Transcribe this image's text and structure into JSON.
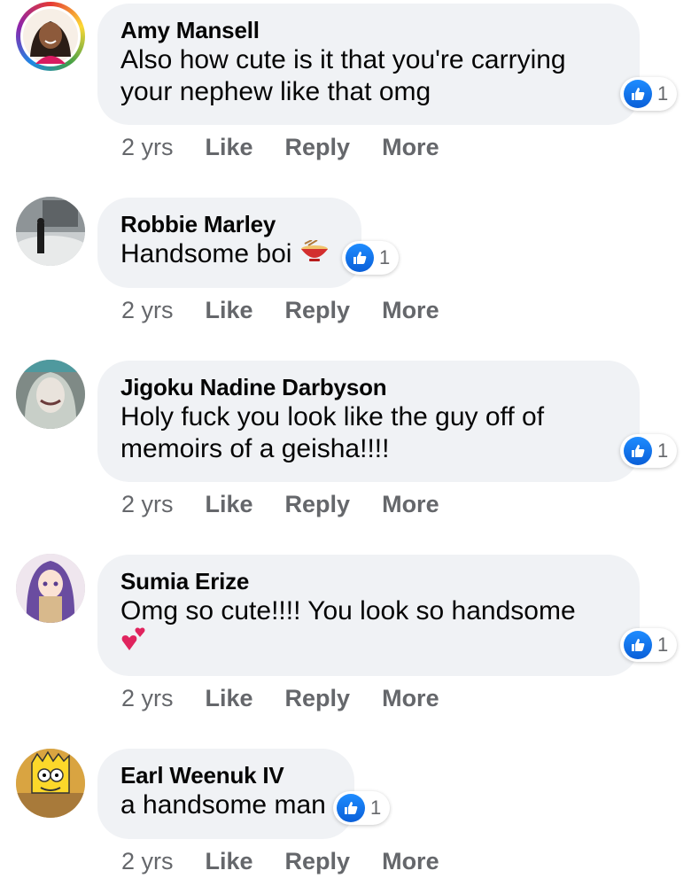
{
  "comments": [
    {
      "name": "Amy Mansell",
      "text_lines": [
        "Also how cute is it that you're carrying",
        "your nephew like that omg"
      ],
      "reaction_count": "1",
      "time": "2 yrs",
      "like": "Like",
      "reply": "Reply",
      "more": "More"
    },
    {
      "name": "Robbie Marley",
      "text": "Handsome boi",
      "emoji": "noodle-bowl-emoji",
      "reaction_count": "1",
      "time": "2 yrs",
      "like": "Like",
      "reply": "Reply",
      "more": "More"
    },
    {
      "name": "Jigoku Nadine Darbyson",
      "text_lines": [
        "Holy fuck you look like the guy off of",
        "memoirs of a geisha!!!!"
      ],
      "reaction_count": "1",
      "time": "2 yrs",
      "like": "Like",
      "reply": "Reply",
      "more": "More"
    },
    {
      "name": "Sumia Erize",
      "text": "Omg so cute!!!! You look so handsome",
      "emoji": "two-hearts-emoji",
      "reaction_count": "1",
      "time": "2 yrs",
      "like": "Like",
      "reply": "Reply",
      "more": "More"
    },
    {
      "name": "Earl Weenuk IV",
      "text": "a handsome man",
      "reaction_count": "1",
      "time": "2 yrs",
      "like": "Like",
      "reply": "Reply",
      "more": "More"
    }
  ],
  "colors": {
    "bubble": "#f0f2f5",
    "like_blue": "#1877f2",
    "meta_text": "#65676b"
  }
}
